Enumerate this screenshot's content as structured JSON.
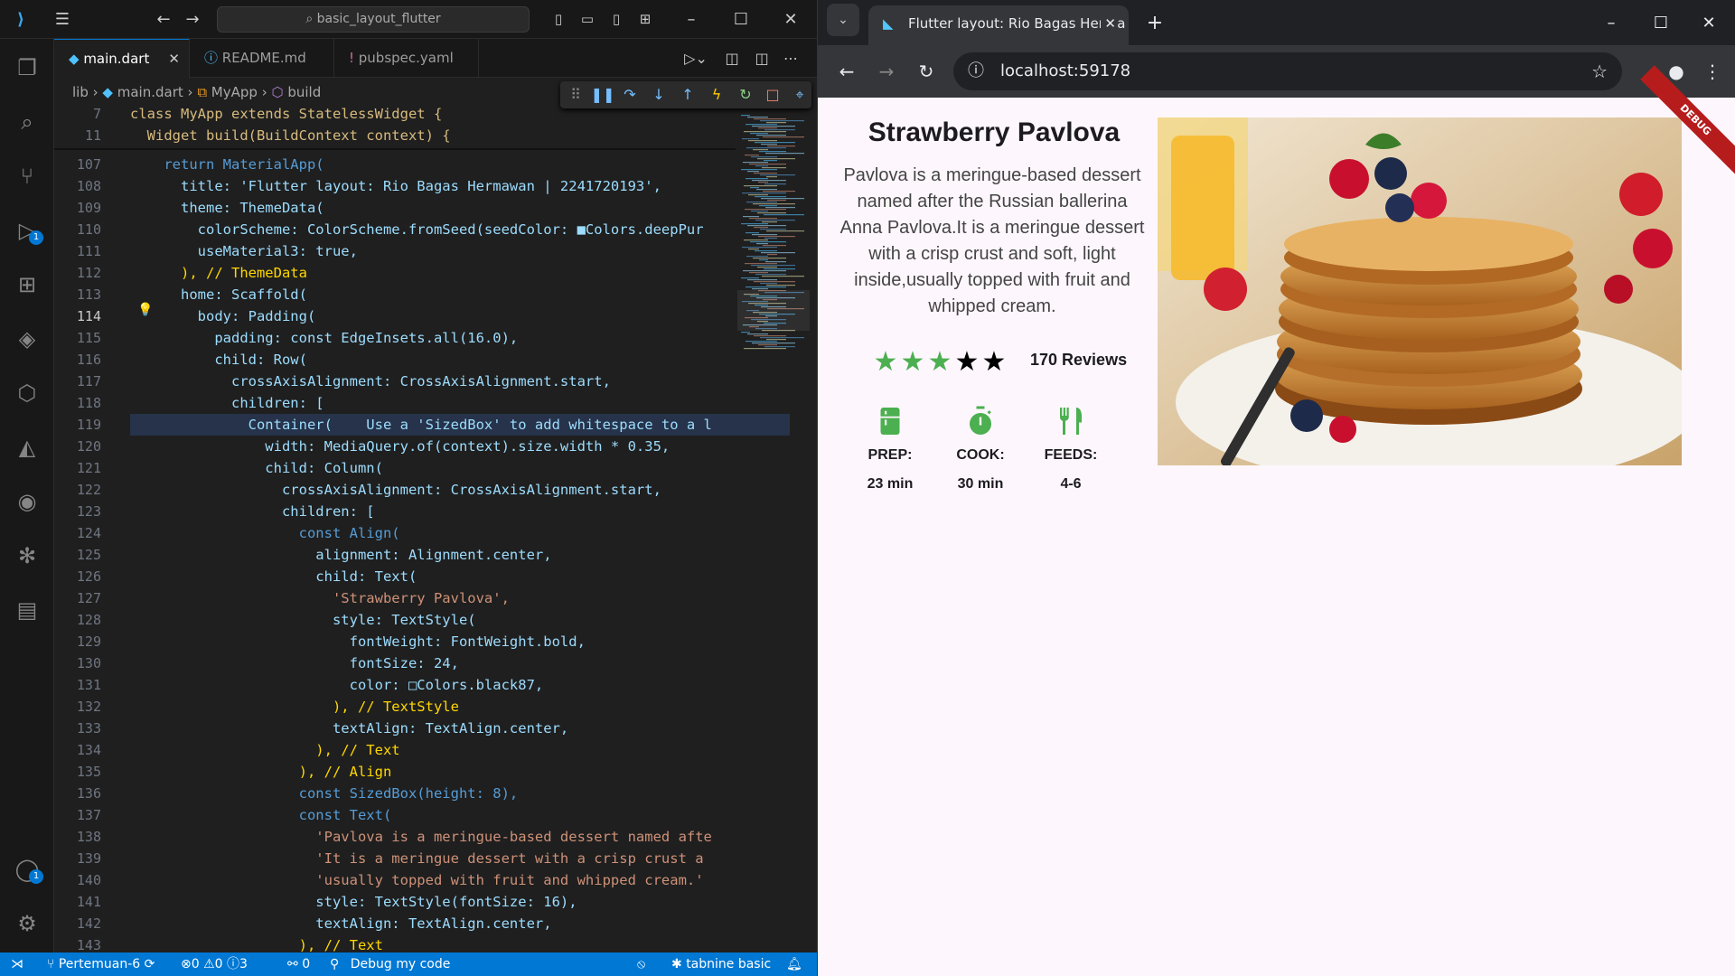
{
  "vscode": {
    "command_center": "basic_layout_flutter",
    "tabs": [
      {
        "label": "main.dart",
        "active": true
      },
      {
        "label": "README.md",
        "active": false
      },
      {
        "label": "pubspec.yaml",
        "active": false
      }
    ],
    "breadcrumb": [
      "lib",
      "main.dart",
      "MyApp",
      "build"
    ],
    "sticky_lines": [
      {
        "num": "7",
        "text": "class MyApp extends StatelessWidget {"
      },
      {
        "num": "11",
        "text": "  Widget build(BuildContext context) {"
      }
    ],
    "code_lines": [
      {
        "num": "107",
        "text": "    return MaterialApp("
      },
      {
        "num": "108",
        "text": "      title: 'Flutter layout: Rio Bagas Hermawan | 2241720193',"
      },
      {
        "num": "109",
        "text": "      theme: ThemeData("
      },
      {
        "num": "110",
        "text": "        colorScheme: ColorScheme.fromSeed(seedColor: ■Colors.deepPur"
      },
      {
        "num": "111",
        "text": "        useMaterial3: true,"
      },
      {
        "num": "112",
        "text": "      ), // ThemeData"
      },
      {
        "num": "113",
        "text": "      home: Scaffold("
      },
      {
        "num": "114",
        "text": "        body: Padding("
      },
      {
        "num": "115",
        "text": "          padding: const EdgeInsets.all(16.0),"
      },
      {
        "num": "116",
        "text": "          child: Row("
      },
      {
        "num": "117",
        "text": "            crossAxisAlignment: CrossAxisAlignment.start,"
      },
      {
        "num": "118",
        "text": "            children: ["
      },
      {
        "num": "119",
        "text": "              Container(    Use a 'SizedBox' to add whitespace to a l"
      },
      {
        "num": "120",
        "text": "                width: MediaQuery.of(context).size.width * 0.35,"
      },
      {
        "num": "121",
        "text": "                child: Column("
      },
      {
        "num": "122",
        "text": "                  crossAxisAlignment: CrossAxisAlignment.start,"
      },
      {
        "num": "123",
        "text": "                  children: ["
      },
      {
        "num": "124",
        "text": "                    const Align("
      },
      {
        "num": "125",
        "text": "                      alignment: Alignment.center,"
      },
      {
        "num": "126",
        "text": "                      child: Text("
      },
      {
        "num": "127",
        "text": "                        'Strawberry Pavlova',"
      },
      {
        "num": "128",
        "text": "                        style: TextStyle("
      },
      {
        "num": "129",
        "text": "                          fontWeight: FontWeight.bold,"
      },
      {
        "num": "130",
        "text": "                          fontSize: 24,"
      },
      {
        "num": "131",
        "text": "                          color: □Colors.black87,"
      },
      {
        "num": "132",
        "text": "                        ), // TextStyle"
      },
      {
        "num": "133",
        "text": "                        textAlign: TextAlign.center,"
      },
      {
        "num": "134",
        "text": "                      ), // Text"
      },
      {
        "num": "135",
        "text": "                    ), // Align"
      },
      {
        "num": "136",
        "text": "                    const SizedBox(height: 8),"
      },
      {
        "num": "137",
        "text": "                    const Text("
      },
      {
        "num": "138",
        "text": "                      'Pavlova is a meringue-based dessert named afte"
      },
      {
        "num": "139",
        "text": "                      'It is a meringue dessert with a crisp crust a"
      },
      {
        "num": "140",
        "text": "                      'usually topped with fruit and whipped cream.'"
      },
      {
        "num": "141",
        "text": "                      style: TextStyle(fontSize: 16),"
      },
      {
        "num": "142",
        "text": "                      textAlign: TextAlign.center,"
      },
      {
        "num": "143",
        "text": "                    ), // Text"
      }
    ],
    "status": {
      "branch": "Pertemuan-6",
      "errors": "0",
      "warnings": "0",
      "infos": "3",
      "ports": "0",
      "debug": "Debug my code",
      "tabnine": "tabnine basic"
    },
    "badges": {
      "debug": "1",
      "accounts": "1"
    }
  },
  "browser": {
    "tab_title": "Flutter layout: Rio Bagas Herma",
    "url": "localhost:59178",
    "debug_banner": "DEBUG"
  },
  "recipe": {
    "title": "Strawberry Pavlova",
    "description": "Pavlova is a meringue-based dessert named after the Russian ballerina Anna Pavlova.It is a meringue dessert with a crisp crust and soft, light inside,usually topped with fruit and whipped cream.",
    "rating": 3,
    "rating_max": 5,
    "reviews": "170 Reviews",
    "info": [
      {
        "icon": "kitchen-icon",
        "label": "PREP:",
        "value": "23 min"
      },
      {
        "icon": "timer-icon",
        "label": "COOK:",
        "value": "30 min"
      },
      {
        "icon": "restaurant-icon",
        "label": "FEEDS:",
        "value": "4-6"
      }
    ],
    "colors": {
      "accent": "#4caf50",
      "star_off": "#000000"
    }
  }
}
